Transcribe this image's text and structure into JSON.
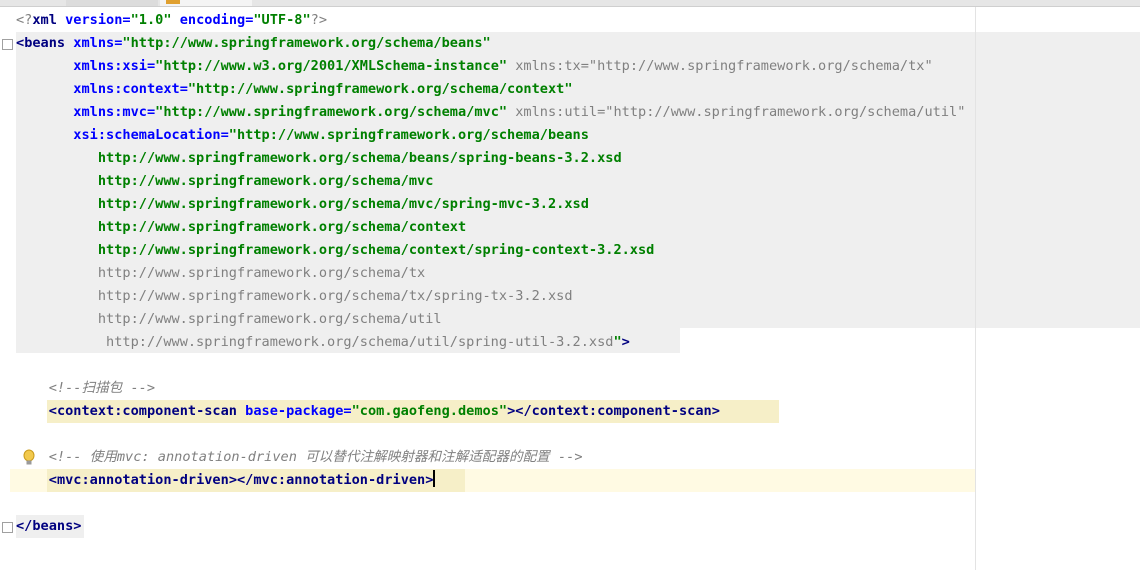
{
  "editor": {
    "line1": {
      "open": "<?",
      "tag": "xml",
      "a1": " version=",
      "v1": "\"1.0\"",
      "a2": " encoding=",
      "v2": "\"UTF-8\"",
      "close": "?>"
    },
    "line2": {
      "open": "<",
      "tag": "beans",
      "a1": " xmlns=",
      "v1": "\"http://www.springframework.org/schema/beans\""
    },
    "line3": {
      "indent": "       ",
      "a1": "xmlns:xsi=",
      "v1": "\"http://www.w3.org/2001/XMLSchema-instance\"",
      "g1": " xmlns:tx=\"http://www.springframework.org/schema/tx\""
    },
    "line4": {
      "indent": "       ",
      "a1": "xmlns:context=",
      "v1": "\"http://www.springframework.org/schema/context\""
    },
    "line5": {
      "indent": "       ",
      "a1": "xmlns:mvc=",
      "v1": "\"http://www.springframework.org/schema/mvc\"",
      "g1": " xmlns:util=\"http://www.springframework.org/schema/util\""
    },
    "line6": {
      "indent": "       ",
      "a1": "xsi:schemaLocation=",
      "v1": "\"http://www.springframework.org/schema/beans"
    },
    "line7": {
      "indent": "          ",
      "v1": "http://www.springframework.org/schema/beans/spring-beans-3.2.xsd"
    },
    "line8": {
      "indent": "          ",
      "v1": "http://www.springframework.org/schema/mvc"
    },
    "line9": {
      "indent": "          ",
      "v1": "http://www.springframework.org/schema/mvc/spring-mvc-3.2.xsd"
    },
    "line10": {
      "indent": "          ",
      "v1": "http://www.springframework.org/schema/context"
    },
    "line11": {
      "indent": "          ",
      "v1": "http://www.springframework.org/schema/context/spring-context-3.2.xsd"
    },
    "line12": {
      "indent": "          ",
      "g1": "http://www.springframework.org/schema/tx"
    },
    "line13": {
      "indent": "          ",
      "g1": "http://www.springframework.org/schema/tx/spring-tx-3.2.xsd"
    },
    "line14": {
      "indent": "          ",
      "g1": "http://www.springframework.org/schema/util"
    },
    "line15": {
      "indent": "           ",
      "g1": "http://www.springframework.org/schema/util/spring-util-3.2.xsd",
      "v1": "\"",
      "close": ">"
    },
    "line17": {
      "indent": "    ",
      "c1": "<!--扫描包 -->"
    },
    "line18": {
      "indent": "    ",
      "open": "<",
      "tag": "context:component-scan",
      "a1": " base-package=",
      "v1": "\"com.gaofeng.demos\"",
      "mid": "></",
      "tag2": "context:component-scan",
      "close": ">"
    },
    "line20": {
      "indent": "    ",
      "c1": "<!-- 使用mvc: annotation-driven 可以替代注解映射器和注解适配器的配置 -->"
    },
    "line21": {
      "indent": "    ",
      "open": "<",
      "tag": "mvc:annotation-driven",
      "mid": "></",
      "tag2": "mvc:annotation-driven",
      "close": ">"
    },
    "line23": {
      "open": "</",
      "tag": "beans",
      "close": ">"
    }
  },
  "colors": {
    "tag": "#000080",
    "attr": "#0000ff",
    "value": "#008000",
    "comment": "#808080",
    "beans_bg": "#efefef",
    "caret_line_bg": "#fffae3",
    "tag_highlight": "#f6efc8"
  }
}
